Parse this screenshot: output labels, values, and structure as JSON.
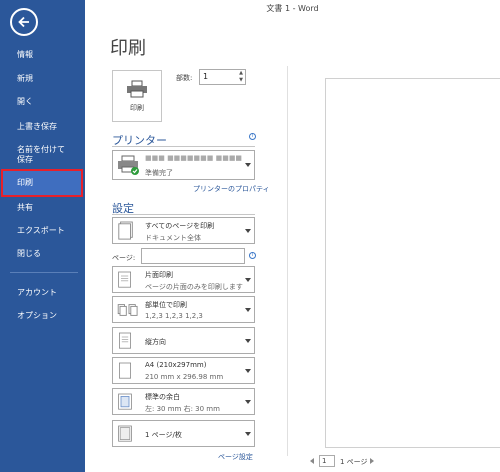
{
  "titlebar": {
    "title": "文書 1 - Word"
  },
  "sidebar": {
    "items": [
      {
        "label": "情報"
      },
      {
        "label": "新規"
      },
      {
        "label": "開く"
      },
      {
        "label": "上書き保存"
      },
      {
        "label": "名前を付けて",
        "label2": "保存"
      },
      {
        "label": "印刷"
      },
      {
        "label": "共有"
      },
      {
        "label": "エクスポート"
      },
      {
        "label": "閉じる"
      },
      {
        "label": "アカウント"
      },
      {
        "label": "オプション"
      }
    ]
  },
  "main": {
    "title": "印刷",
    "print_button_label": "印刷",
    "copies_label": "部数:",
    "copies_value": "1"
  },
  "printer": {
    "section_title": "プリンター",
    "name": "■■■ ■■■■■■■ ■■■■",
    "status": "準備完了",
    "properties_link": "プリンターのプロパティ"
  },
  "settings": {
    "section_title": "設定",
    "range_main": "すべてのページを印刷",
    "range_sub": "ドキュメント全体",
    "pages_label": "ページ:",
    "sides_main": "片面印刷",
    "sides_sub": "ページの片面のみを印刷します",
    "collate_main": "部単位で印刷",
    "collate_sub": "1,2,3    1,2,3    1,2,3",
    "orientation_main": "縦方向",
    "paper_main": "A4 (210x297mm)",
    "paper_sub": "210 mm x 296.98 mm",
    "margins_main": "標準の余白",
    "margins_sub": "左:  30 mm    右:  30 mm",
    "pps_main": "1 ページ/枚",
    "page_setup_link": "ページ設定"
  },
  "preview": {
    "current_page": "1",
    "total_pages": "1 ページ"
  }
}
